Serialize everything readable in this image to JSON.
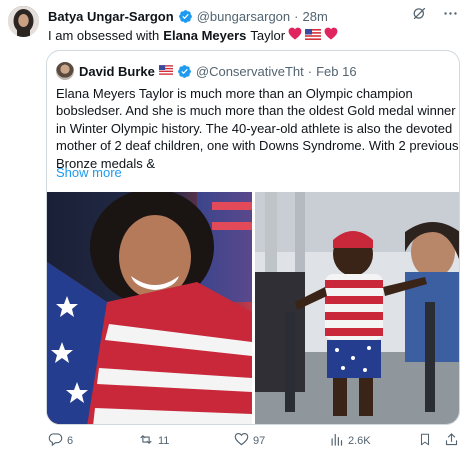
{
  "tweet": {
    "author_name": "Batya Ungar-Sargon",
    "author_handle": "@bungarsargon",
    "separator": "·",
    "time": "28m",
    "text_before": "I am obsessed with",
    "text_bold": "Elana Meyers",
    "text_after": "Taylor",
    "emoji_trailing": "heart-usflag-heart"
  },
  "quote": {
    "author_name": "David Burke",
    "author_handle": "@ConservativeTht",
    "separator": "·",
    "date": "Feb 16",
    "lines": [
      "Elana Meyers Taylor is much more than an Olympic champion",
      "bobsledser. And she is much more than the oldest Gold medal winner",
      "in Winter Olympic history. The 40-year-old athlete is also the devoted",
      "mother of 2 deaf children, one with Downs Syndrome. With 2 previous",
      "Bronze medals &"
    ],
    "show_more": "Show more"
  },
  "actions": {
    "replies": "6",
    "reposts": "11",
    "likes": "97",
    "views": "2.6K"
  },
  "icons": {
    "header": [
      "verified-badge-icon",
      "grok-icon",
      "more-icon"
    ],
    "actions": [
      "reply-icon",
      "repost-icon",
      "like-icon",
      "views-icon",
      "bookmark-icon",
      "share-icon"
    ]
  },
  "colors": {
    "accent": "#1d9bf0",
    "secondary_text": "#536471",
    "heart": "#e0245e",
    "border": "#cfd9de"
  }
}
